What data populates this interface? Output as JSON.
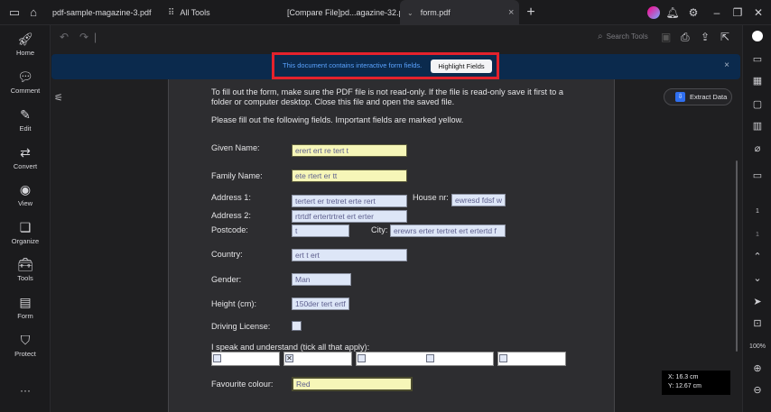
{
  "tabs": [
    {
      "label": "pdf-sample-magazine-3.pdf"
    },
    {
      "label": "All Tools"
    },
    {
      "label": "[Compare  File]pd...agazine-32.pdf *"
    },
    {
      "label": "form.pdf"
    }
  ],
  "sidebar": {
    "items": [
      {
        "label": "Home",
        "icon": "rocket-icon"
      },
      {
        "label": "Comment",
        "icon": "comment-icon"
      },
      {
        "label": "Edit",
        "icon": "edit-icon"
      },
      {
        "label": "Convert",
        "icon": "convert-icon"
      },
      {
        "label": "View",
        "icon": "eye-icon"
      },
      {
        "label": "Organize",
        "icon": "organize-icon"
      },
      {
        "label": "Tools",
        "icon": "toolbox-icon"
      },
      {
        "label": "Form",
        "icon": "form-icon"
      },
      {
        "label": "Protect",
        "icon": "shield-icon"
      }
    ],
    "more": "···"
  },
  "toolbar": {
    "search_label": "Search Tools"
  },
  "banner": {
    "message": "This document contains interactive form fields.",
    "button": "Highlight Fields",
    "close": "×"
  },
  "extract": {
    "label": "Extract Data"
  },
  "form": {
    "intro1": "To fill out the form, make sure the PDF file is not read-only. If the file is read-only save it first to a",
    "intro2": "folder or computer desktop. Close this file and open the saved file.",
    "intro3": "Please fill out the following fields. Important fields are marked yellow.",
    "given_name_label": "Given Name:",
    "given_name_value": "erert ert re tert t",
    "family_name_label": "Family Name:",
    "family_name_value": "ete rtert er tt",
    "address1_label": "Address 1:",
    "address1_value": "tertert er tretret  erte rert",
    "house_label": "House nr:",
    "house_value": "ewresd fdsf w",
    "address2_label": "Address 2:",
    "address2_value": "rtrtdf ertertrtret ert erter",
    "postcode_label": "Postcode:",
    "postcode_value": "t",
    "city_label": "City:",
    "city_value": "erewrs erter tertret ert ertertd f",
    "country_label": "Country:",
    "country_value": "ert t ert",
    "gender_label": "Gender:",
    "gender_value": "Man",
    "height_label": "Height (cm):",
    "height_value": "150der tert ertf",
    "driving_label": "Driving License:",
    "languages_label": "I speak and understand (tick all that apply):",
    "colour_label": "Favourite colour:",
    "colour_value": "Red"
  },
  "coords": {
    "x": "X: 16.3 cm",
    "y": "Y: 12.67 cm"
  },
  "rightbar": {
    "page_current": "1",
    "page_total": "1",
    "zoom": "100%"
  }
}
